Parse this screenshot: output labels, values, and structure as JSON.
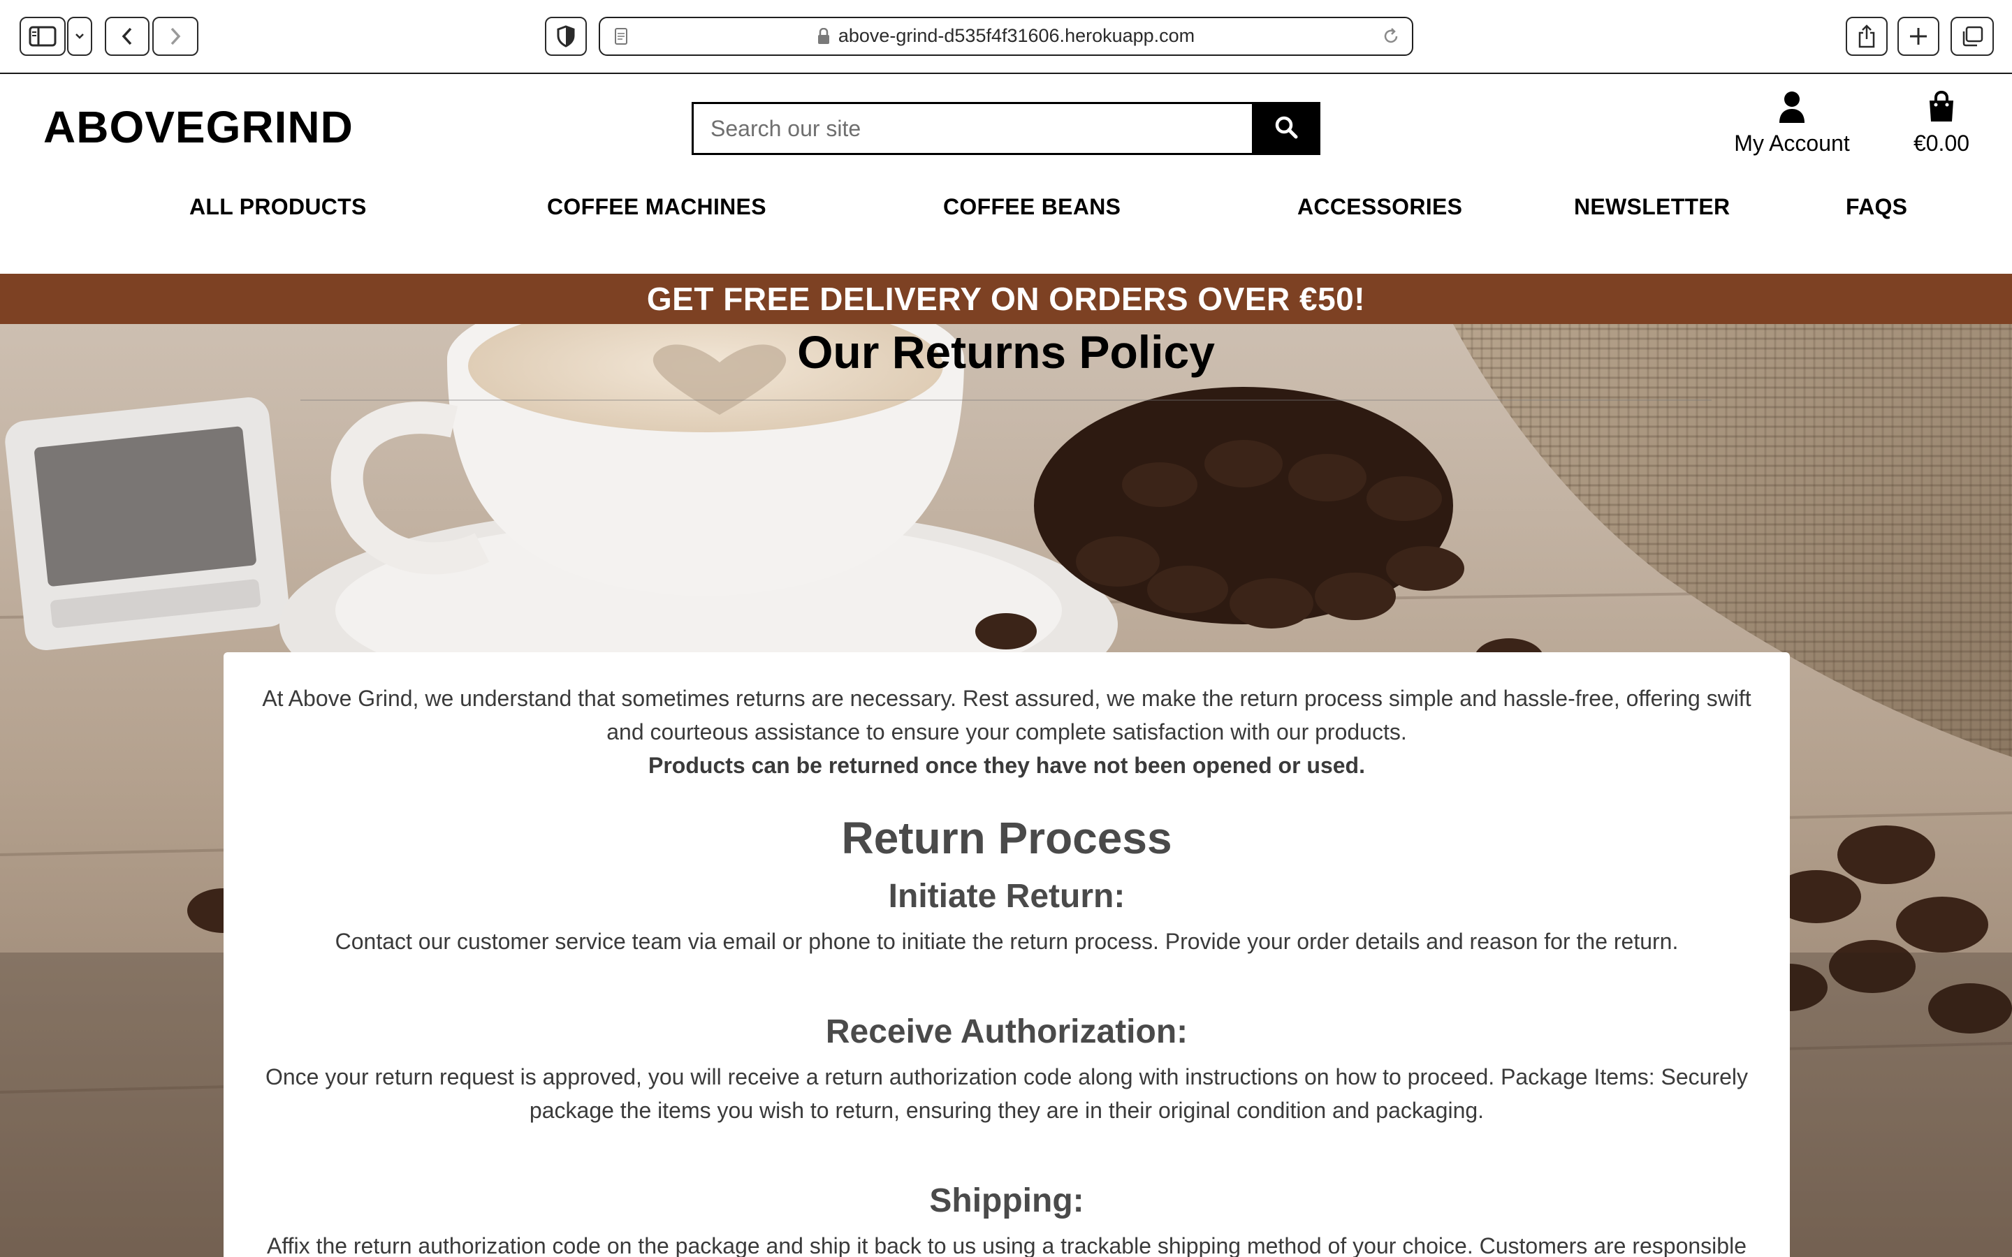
{
  "browser": {
    "url": "above-grind-d535f4f31606.herokuapp.com"
  },
  "header": {
    "logo": "ABOVEGRIND",
    "search_placeholder": "Search our site",
    "account_label": "My Account",
    "cart_total": "€0.00"
  },
  "nav": {
    "items": [
      "ALL PRODUCTS",
      "COFFEE MACHINES",
      "COFFEE BEANS",
      "ACCESSORIES",
      "NEWSLETTER",
      "FAQS"
    ]
  },
  "banner": {
    "text": "GET FREE DELIVERY ON ORDERS OVER €50!"
  },
  "page": {
    "title": "Our Returns Policy",
    "intro": "At Above Grind, we understand that sometimes returns are necessary. Rest assured, we make the return process simple and hassle-free, offering swift and courteous assistance to ensure your complete satisfaction with our products.",
    "intro_bold": "Products can be returned once they have not been opened or used.",
    "process_heading": "Return Process",
    "steps": [
      {
        "title": "Initiate Return:",
        "text": "Contact our customer service team via email or phone to initiate the return process. Provide your order details and reason for the return."
      },
      {
        "title": "Receive Authorization:",
        "text": "Once your return request is approved, you will receive a return authorization code along with instructions on how to proceed. Package Items: Securely package the items you wish to return, ensuring they are in their original condition and packaging."
      },
      {
        "title": "Shipping:",
        "text": "Affix the return authorization code on the package and ship it back to us using a trackable shipping method of your choice. Customers are responsible"
      }
    ]
  },
  "colors": {
    "banner": "#7d4123",
    "text_dark": "#000000",
    "text_body": "#3a3a3a"
  },
  "icons": [
    "sidebar-icon",
    "chevron-down-icon",
    "back-arrow-icon",
    "forward-arrow-icon",
    "privacy-shield-icon",
    "page-icon",
    "lock-icon",
    "reload-icon",
    "share-icon",
    "new-tab-icon",
    "tabs-icon",
    "search-icon",
    "user-icon",
    "shopping-bag-icon"
  ]
}
